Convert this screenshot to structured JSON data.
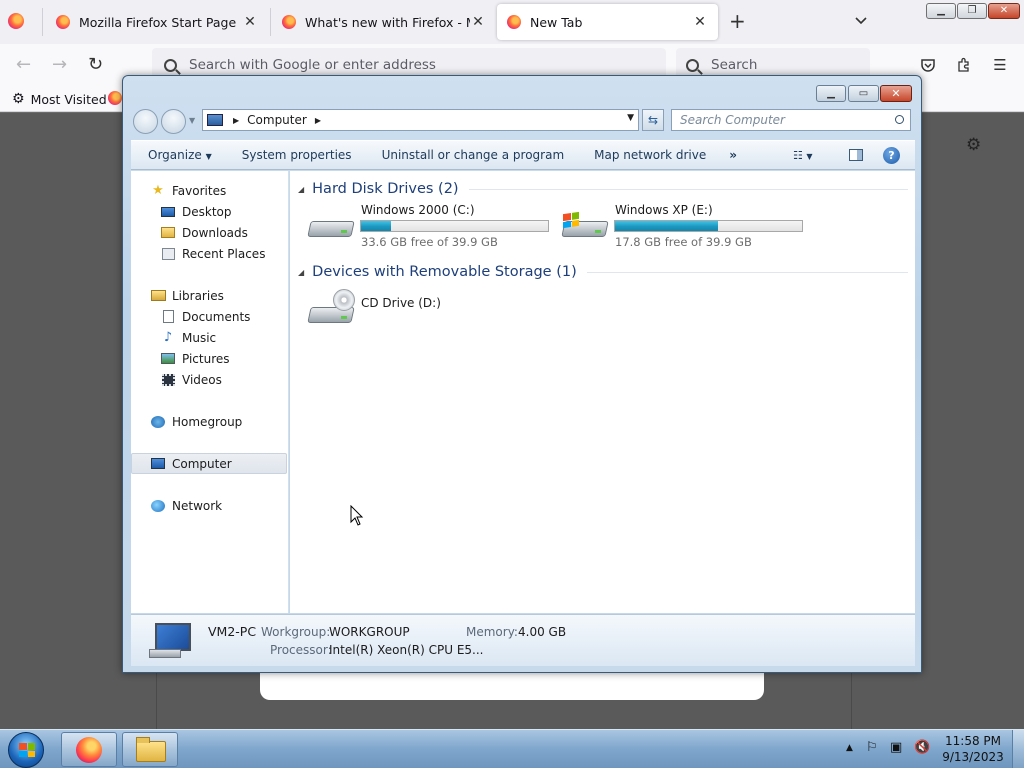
{
  "firefox": {
    "tabs": [
      {
        "title": "Mozilla Firefox Start Page",
        "active": false
      },
      {
        "title": "What's new with Firefox - More",
        "active": false
      },
      {
        "title": "New Tab",
        "active": true
      }
    ],
    "urlbar_placeholder": "Search with Google or enter address",
    "search_placeholder": "Search",
    "bookmarks": {
      "most_visited": "Most Visited"
    }
  },
  "explorer": {
    "address": {
      "location": "Computer"
    },
    "search_placeholder": "Search Computer",
    "commands": {
      "organize": "Organize",
      "system_properties": "System properties",
      "uninstall": "Uninstall or change a program",
      "map_drive": "Map network drive",
      "more": "»"
    },
    "nav": {
      "favorites": "Favorites",
      "desktop": "Desktop",
      "downloads": "Downloads",
      "recent_places": "Recent Places",
      "libraries": "Libraries",
      "documents": "Documents",
      "music": "Music",
      "pictures": "Pictures",
      "videos": "Videos",
      "homegroup": "Homegroup",
      "computer": "Computer",
      "network": "Network"
    },
    "groups": {
      "hdd": "Hard Disk Drives (2)",
      "removable": "Devices with Removable Storage (1)"
    },
    "drives": [
      {
        "name": "Windows 2000 (C:)",
        "free": "33.6 GB free of 39.9 GB",
        "used_fraction": 0.16
      },
      {
        "name": "Windows XP (E:)",
        "free": "17.8 GB free of 39.9 GB",
        "used_fraction": 0.55
      }
    ],
    "removable": [
      {
        "name": "CD Drive (D:)"
      }
    ],
    "details": {
      "pc_name": "VM2-PC",
      "workgroup_label": "Workgroup:",
      "workgroup": "WORKGROUP",
      "memory_label": "Memory:",
      "memory": "4.00 GB",
      "processor_label": "Processor:",
      "processor": "Intel(R) Xeon(R) CPU E5..."
    }
  },
  "taskbar": {
    "time": "11:58 PM",
    "date": "9/13/2023"
  }
}
